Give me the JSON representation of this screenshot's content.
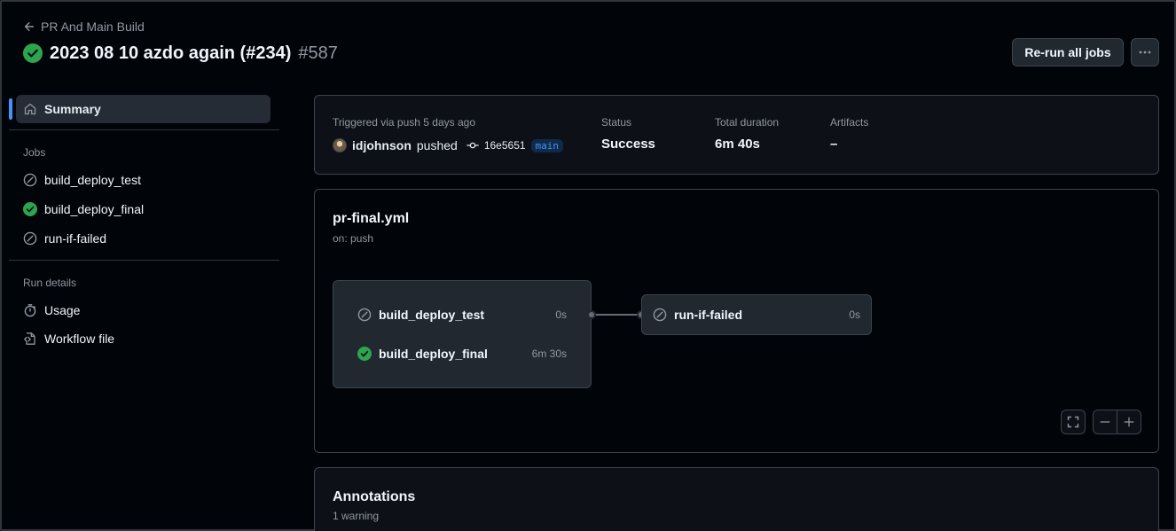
{
  "header": {
    "back_label": "PR And Main Build",
    "title": "2023 08 10 azdo again (#234)",
    "run_number": "#587",
    "rerun_label": "Re-run all jobs",
    "more_label": "···"
  },
  "sidebar": {
    "summary_label": "Summary",
    "jobs_heading": "Jobs",
    "jobs": [
      {
        "label": "build_deploy_test",
        "status": "skipped"
      },
      {
        "label": "build_deploy_final",
        "status": "success"
      },
      {
        "label": "run-if-failed",
        "status": "skipped"
      }
    ],
    "run_details_heading": "Run details",
    "usage_label": "Usage",
    "workflow_file_label": "Workflow file"
  },
  "summary": {
    "trigger_label": "Triggered via push 5 days ago",
    "actor": "idjohnson",
    "action": "pushed",
    "commit_sha": "16e5651",
    "branch": "main",
    "status_label": "Status",
    "status_value": "Success",
    "duration_label": "Total duration",
    "duration_value": "6m 40s",
    "artifacts_label": "Artifacts",
    "artifacts_value": "–"
  },
  "workflow": {
    "file": "pr-final.yml",
    "trigger": "on: push",
    "group_jobs": [
      {
        "name": "build_deploy_test",
        "duration": "0s",
        "status": "skipped"
      },
      {
        "name": "build_deploy_final",
        "duration": "6m 30s",
        "status": "success"
      }
    ],
    "downstream_job": {
      "name": "run-if-failed",
      "duration": "0s",
      "status": "skipped"
    }
  },
  "annotations": {
    "title": "Annotations",
    "count_text": "1 warning"
  },
  "colors": {
    "success": "#2da44e",
    "accent": "#4493f8",
    "background": "#010409",
    "panel": "#0d1117",
    "muted": "#9198a1"
  }
}
